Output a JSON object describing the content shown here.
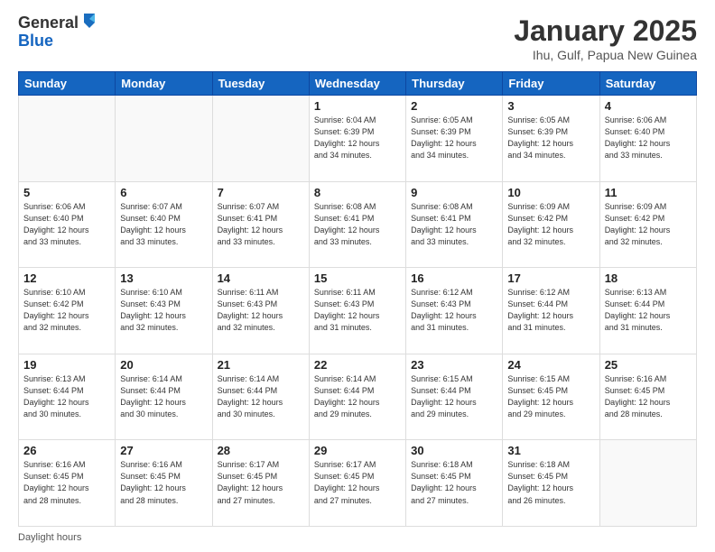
{
  "logo": {
    "general": "General",
    "blue": "Blue"
  },
  "header": {
    "month": "January 2025",
    "location": "Ihu, Gulf, Papua New Guinea"
  },
  "weekdays": [
    "Sunday",
    "Monday",
    "Tuesday",
    "Wednesday",
    "Thursday",
    "Friday",
    "Saturday"
  ],
  "footer": {
    "label": "Daylight hours"
  },
  "weeks": [
    [
      {
        "day": "",
        "info": ""
      },
      {
        "day": "",
        "info": ""
      },
      {
        "day": "",
        "info": ""
      },
      {
        "day": "1",
        "info": "Sunrise: 6:04 AM\nSunset: 6:39 PM\nDaylight: 12 hours\nand 34 minutes."
      },
      {
        "day": "2",
        "info": "Sunrise: 6:05 AM\nSunset: 6:39 PM\nDaylight: 12 hours\nand 34 minutes."
      },
      {
        "day": "3",
        "info": "Sunrise: 6:05 AM\nSunset: 6:39 PM\nDaylight: 12 hours\nand 34 minutes."
      },
      {
        "day": "4",
        "info": "Sunrise: 6:06 AM\nSunset: 6:40 PM\nDaylight: 12 hours\nand 33 minutes."
      }
    ],
    [
      {
        "day": "5",
        "info": "Sunrise: 6:06 AM\nSunset: 6:40 PM\nDaylight: 12 hours\nand 33 minutes."
      },
      {
        "day": "6",
        "info": "Sunrise: 6:07 AM\nSunset: 6:40 PM\nDaylight: 12 hours\nand 33 minutes."
      },
      {
        "day": "7",
        "info": "Sunrise: 6:07 AM\nSunset: 6:41 PM\nDaylight: 12 hours\nand 33 minutes."
      },
      {
        "day": "8",
        "info": "Sunrise: 6:08 AM\nSunset: 6:41 PM\nDaylight: 12 hours\nand 33 minutes."
      },
      {
        "day": "9",
        "info": "Sunrise: 6:08 AM\nSunset: 6:41 PM\nDaylight: 12 hours\nand 33 minutes."
      },
      {
        "day": "10",
        "info": "Sunrise: 6:09 AM\nSunset: 6:42 PM\nDaylight: 12 hours\nand 32 minutes."
      },
      {
        "day": "11",
        "info": "Sunrise: 6:09 AM\nSunset: 6:42 PM\nDaylight: 12 hours\nand 32 minutes."
      }
    ],
    [
      {
        "day": "12",
        "info": "Sunrise: 6:10 AM\nSunset: 6:42 PM\nDaylight: 12 hours\nand 32 minutes."
      },
      {
        "day": "13",
        "info": "Sunrise: 6:10 AM\nSunset: 6:43 PM\nDaylight: 12 hours\nand 32 minutes."
      },
      {
        "day": "14",
        "info": "Sunrise: 6:11 AM\nSunset: 6:43 PM\nDaylight: 12 hours\nand 32 minutes."
      },
      {
        "day": "15",
        "info": "Sunrise: 6:11 AM\nSunset: 6:43 PM\nDaylight: 12 hours\nand 31 minutes."
      },
      {
        "day": "16",
        "info": "Sunrise: 6:12 AM\nSunset: 6:43 PM\nDaylight: 12 hours\nand 31 minutes."
      },
      {
        "day": "17",
        "info": "Sunrise: 6:12 AM\nSunset: 6:44 PM\nDaylight: 12 hours\nand 31 minutes."
      },
      {
        "day": "18",
        "info": "Sunrise: 6:13 AM\nSunset: 6:44 PM\nDaylight: 12 hours\nand 31 minutes."
      }
    ],
    [
      {
        "day": "19",
        "info": "Sunrise: 6:13 AM\nSunset: 6:44 PM\nDaylight: 12 hours\nand 30 minutes."
      },
      {
        "day": "20",
        "info": "Sunrise: 6:14 AM\nSunset: 6:44 PM\nDaylight: 12 hours\nand 30 minutes."
      },
      {
        "day": "21",
        "info": "Sunrise: 6:14 AM\nSunset: 6:44 PM\nDaylight: 12 hours\nand 30 minutes."
      },
      {
        "day": "22",
        "info": "Sunrise: 6:14 AM\nSunset: 6:44 PM\nDaylight: 12 hours\nand 29 minutes."
      },
      {
        "day": "23",
        "info": "Sunrise: 6:15 AM\nSunset: 6:44 PM\nDaylight: 12 hours\nand 29 minutes."
      },
      {
        "day": "24",
        "info": "Sunrise: 6:15 AM\nSunset: 6:45 PM\nDaylight: 12 hours\nand 29 minutes."
      },
      {
        "day": "25",
        "info": "Sunrise: 6:16 AM\nSunset: 6:45 PM\nDaylight: 12 hours\nand 28 minutes."
      }
    ],
    [
      {
        "day": "26",
        "info": "Sunrise: 6:16 AM\nSunset: 6:45 PM\nDaylight: 12 hours\nand 28 minutes."
      },
      {
        "day": "27",
        "info": "Sunrise: 6:16 AM\nSunset: 6:45 PM\nDaylight: 12 hours\nand 28 minutes."
      },
      {
        "day": "28",
        "info": "Sunrise: 6:17 AM\nSunset: 6:45 PM\nDaylight: 12 hours\nand 27 minutes."
      },
      {
        "day": "29",
        "info": "Sunrise: 6:17 AM\nSunset: 6:45 PM\nDaylight: 12 hours\nand 27 minutes."
      },
      {
        "day": "30",
        "info": "Sunrise: 6:18 AM\nSunset: 6:45 PM\nDaylight: 12 hours\nand 27 minutes."
      },
      {
        "day": "31",
        "info": "Sunrise: 6:18 AM\nSunset: 6:45 PM\nDaylight: 12 hours\nand 26 minutes."
      },
      {
        "day": "",
        "info": ""
      }
    ]
  ]
}
